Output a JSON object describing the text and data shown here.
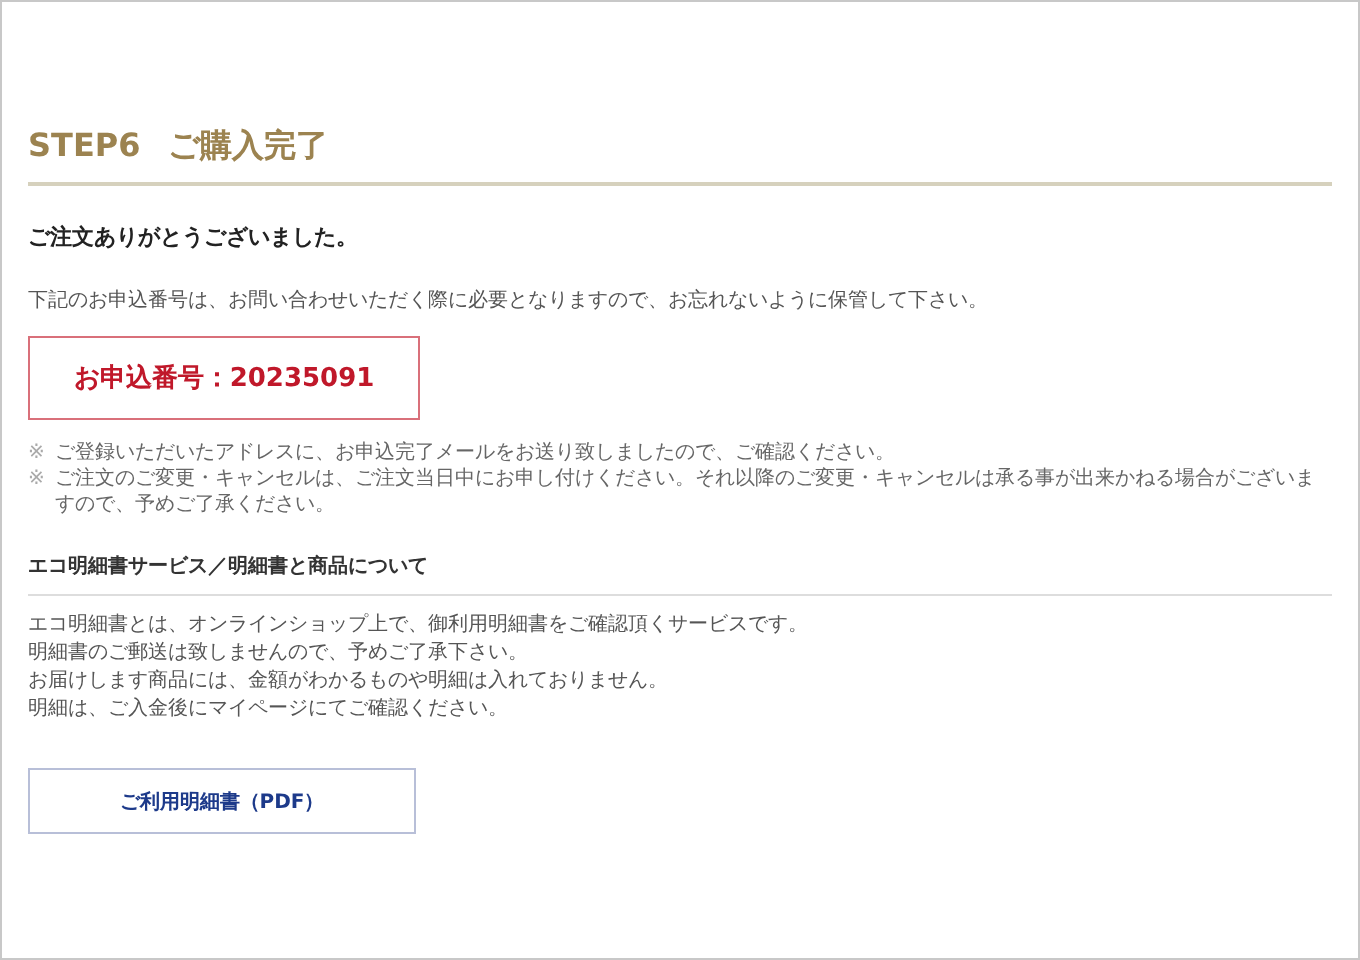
{
  "title": {
    "step": "STEP6",
    "label": "ご購入完了"
  },
  "thanks": "ご注文ありがとうございました。",
  "intro": "下記のお申込番号は、お問い合わせいただく際に必要となりますので、お忘れないように保管して下さい。",
  "order_number": "お申込番号：20235091",
  "notes": [
    {
      "mark": "※",
      "text": "ご登録いただいたアドレスに、お申込完了メールをお送り致しましたので、ご確認ください。"
    },
    {
      "mark": "※",
      "text": "ご注文のご変更・キャンセルは、ご注文当日中にお申し付けください。それ以降のご変更・キャンセルは承る事が出来かねる場合がございますので、予めご了承ください。"
    }
  ],
  "section": {
    "heading": "エコ明細書サービス／明細書と商品について",
    "lines": [
      "エコ明細書とは、オンラインショップ上で、御利用明細書をご確認頂くサービスです。",
      "明細書のご郵送は致しませんので、予めご了承下さい。",
      "お届けします商品には、金額がわかるものや明細は入れておりません。",
      "明細は、ご入金後にマイページにてご確認ください。"
    ]
  },
  "button": "ご利用明細書（PDF）"
}
